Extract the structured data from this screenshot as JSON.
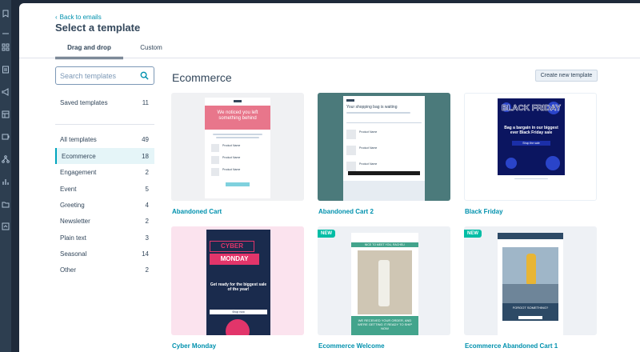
{
  "nav": {
    "back_label": "Back to emails",
    "page_title": "Select a template"
  },
  "tabs": [
    {
      "label": "Drag and drop",
      "active": true
    },
    {
      "label": "Custom",
      "active": false
    }
  ],
  "search": {
    "placeholder": "Search templates",
    "value": ""
  },
  "saved": {
    "label": "Saved templates",
    "count": "11"
  },
  "categories": [
    {
      "label": "All templates",
      "count": "49",
      "active": false
    },
    {
      "label": "Ecommerce",
      "count": "18",
      "active": true
    },
    {
      "label": "Engagement",
      "count": "2",
      "active": false
    },
    {
      "label": "Event",
      "count": "5",
      "active": false
    },
    {
      "label": "Greeting",
      "count": "4",
      "active": false
    },
    {
      "label": "Newsletter",
      "count": "2",
      "active": false
    },
    {
      "label": "Plain text",
      "count": "3",
      "active": false
    },
    {
      "label": "Seasonal",
      "count": "14",
      "active": false
    },
    {
      "label": "Other",
      "count": "2",
      "active": false
    }
  ],
  "main": {
    "section_title": "Ecommerce",
    "create_button": "Create new template"
  },
  "templates": [
    {
      "name": "Abandoned Cart",
      "badge": "",
      "preview_headline": "We noticed you left something behind",
      "preview_product_label": "Product Name",
      "bg_color": "#f0f1f3",
      "accent": "#e8768b"
    },
    {
      "name": "Abandoned Cart 2",
      "badge": "",
      "preview_headline": "Your shopping bag is waiting",
      "preview_product_label": "Product Name",
      "bg_color": "#4b7a7b",
      "accent": "#1a1a1a"
    },
    {
      "name": "Black Friday",
      "badge": "",
      "preview_headline": "BLACK FRIDAY",
      "preview_sub": "Bag a bargain in our biggest ever Black Friday sale",
      "preview_cta": "Shop the sale",
      "bg_color": "#ffffff",
      "accent": "#1b2fa8"
    },
    {
      "name": "Cyber Monday",
      "badge": "",
      "preview_headline": "CYBER MONDAY",
      "preview_sub": "Get ready for the biggest sale of the year!",
      "preview_cta": "Shop now",
      "bg_color": "#fbe3ee",
      "accent": "#e2356a"
    },
    {
      "name": "Ecommerce Welcome",
      "badge": "NEW",
      "preview_headline": "WE RECEIVED YOUR ORDER, AND WE'RE GETTING IT READY TO SHIP NOW",
      "preview_top": "NICE TO MEET YOU, RACHEL!",
      "bg_color": "#eef1f5",
      "accent": "#43a48c"
    },
    {
      "name": "Ecommerce Abandoned Cart 1",
      "badge": "NEW",
      "preview_headline": "FORGOT SOMETHING?",
      "bg_color": "#eef1f5",
      "accent": "#2d4a66"
    }
  ],
  "colors": {
    "accent": "#00a4bd",
    "link": "#0091ae",
    "text": "#33475b",
    "badge": "#00bda5"
  }
}
